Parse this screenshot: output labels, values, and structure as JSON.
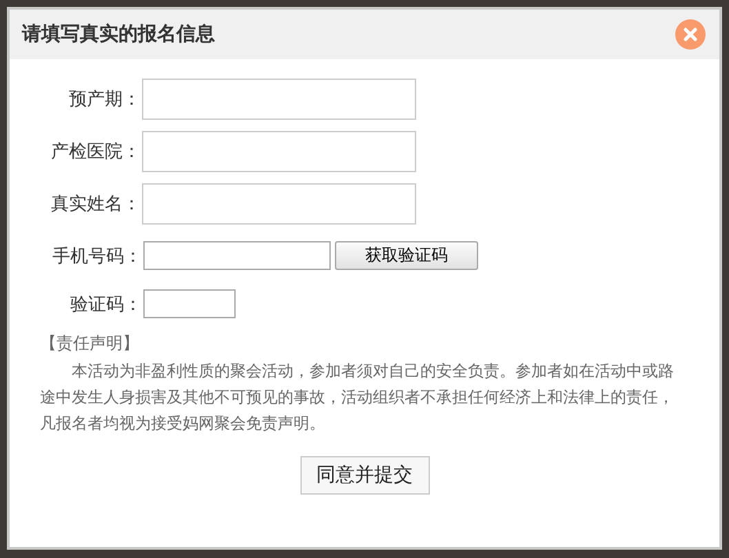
{
  "dialog": {
    "title": "请填写真实的报名信息"
  },
  "fields": [
    {
      "kind": "text",
      "label": "预产期："
    },
    {
      "kind": "text",
      "label": "产检医院："
    },
    {
      "kind": "text",
      "label": "真实姓名："
    },
    {
      "kind": "phone",
      "label": "手机号码：",
      "button": "获取验证码"
    },
    {
      "kind": "code",
      "label": "验证码："
    }
  ],
  "statement": {
    "heading": "【责任声明】",
    "text": "本活动为非盈利性质的聚会活动，参加者须对自己的安全负责。参加者如在活动中或路途中发生人身损害及其他不可预见的事故，活动组织者不承担任何经济上和法律上的责任，凡报名者均视为接受妈网聚会免责声明。"
  },
  "submit": "同意并提交"
}
